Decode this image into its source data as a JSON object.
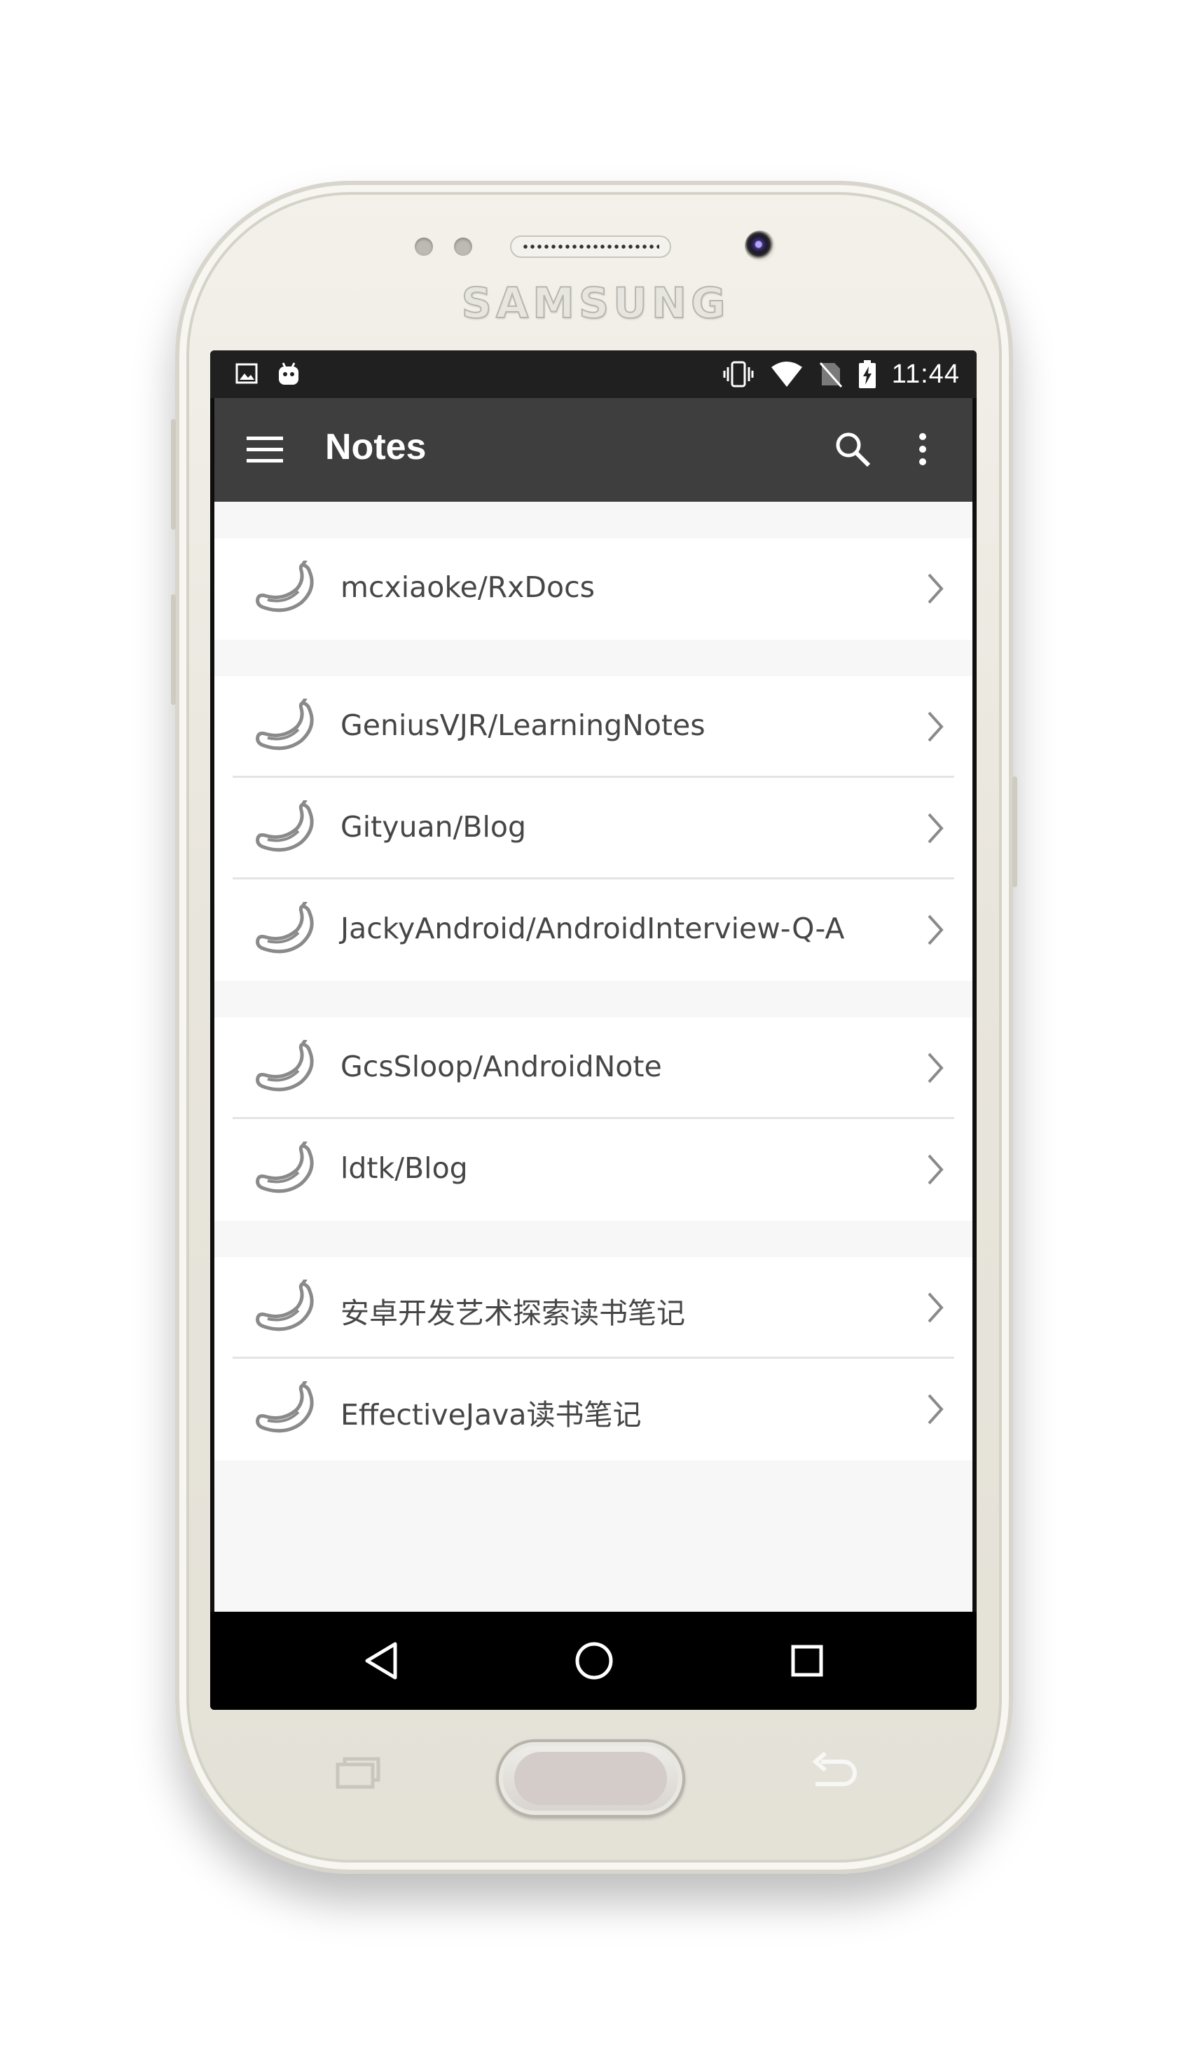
{
  "device": {
    "brand": "SAMSUNG"
  },
  "status_bar": {
    "left_icons": [
      "image-notification-icon",
      "android-notification-icon"
    ],
    "right_icons": [
      "vibrate-icon",
      "wifi-icon",
      "no-sim-icon",
      "battery-charging-icon"
    ],
    "time": "11:44"
  },
  "app_bar": {
    "title": "Notes",
    "menu_icon": "hamburger-menu-icon",
    "search_icon": "search-icon",
    "more_icon": "more-vert-icon",
    "background_color": "#3e3e3e"
  },
  "list": {
    "item_icon": "banana-icon",
    "item_trailing_icon": "chevron-right-icon",
    "groups": [
      {
        "items": [
          {
            "label": "mcxiaoke/RxDocs"
          }
        ]
      },
      {
        "items": [
          {
            "label": "GeniusVJR/LearningNotes"
          },
          {
            "label": "Gityuan/Blog"
          },
          {
            "label": "JackyAndroid/AndroidInterview-Q-A"
          }
        ]
      },
      {
        "items": [
          {
            "label": "GcsSloop/AndroidNote"
          },
          {
            "label": "ldtk/Blog"
          }
        ]
      },
      {
        "items": [
          {
            "label": "安卓开发艺术探索读书笔记"
          },
          {
            "label": "EffectiveJava读书笔记"
          }
        ]
      }
    ]
  },
  "nav_bar": {
    "back_icon": "back-triangle-icon",
    "home_icon": "home-circle-icon",
    "recents_icon": "recents-square-icon"
  }
}
